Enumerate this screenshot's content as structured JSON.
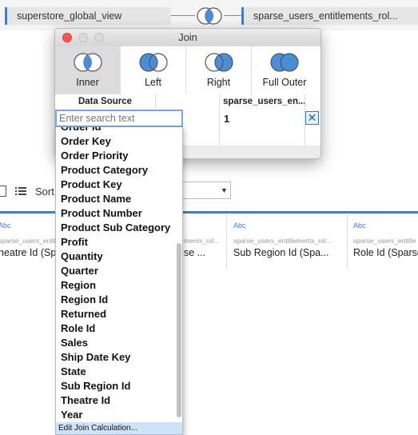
{
  "join_bar": {
    "left_table": "superstore_global_view",
    "right_table": "sparse_users_entitlements_rol...",
    "join_type_icon": "inner-join-venn-icon"
  },
  "dialog": {
    "title": "Join",
    "join_types": [
      {
        "label": "Inner",
        "selected": true
      },
      {
        "label": "Left",
        "selected": false
      },
      {
        "label": "Right",
        "selected": false
      },
      {
        "label": "Full Outer",
        "selected": false
      }
    ],
    "columns": {
      "left_header": "Data Source",
      "right_header": "sparse_users_en..."
    },
    "clause": {
      "right_value": "1",
      "remove_icon": "x-icon"
    }
  },
  "search": {
    "placeholder": "Enter search text",
    "value": ""
  },
  "field_list": {
    "items": [
      "Order Id",
      "Order Key",
      "Order Priority",
      "Product Category",
      "Product Key",
      "Product Name",
      "Product Number",
      "Product Sub Category",
      "Profit",
      "Quantity",
      "Quarter",
      "Region",
      "Region Id",
      "Returned",
      "Role Id",
      "Sales",
      "Ship Date Key",
      "State",
      "Sub Region Id",
      "Theatre Id",
      "Year"
    ],
    "edit_calc_label": "Edit Join Calculation..."
  },
  "grid_toolbar": {
    "sort_label": "Sort"
  },
  "grid_columns": [
    {
      "type": "Abc",
      "source": "sparse_users_entit",
      "name": "heatre Id (Sp"
    },
    {
      "type": "",
      "source": "ments_rol...",
      "name": "se ..."
    },
    {
      "type": "Abc",
      "source": "sparse_users_entitlements_rol...",
      "name": "Sub Region Id (Spa..."
    },
    {
      "type": "Abc",
      "source": "sparse_users_entitle",
      "name": "Role Id (Sparse"
    }
  ],
  "colors": {
    "accent": "#4a7bc0",
    "venn_fill": "#4a8ed8",
    "close_red": "#fc5753"
  }
}
